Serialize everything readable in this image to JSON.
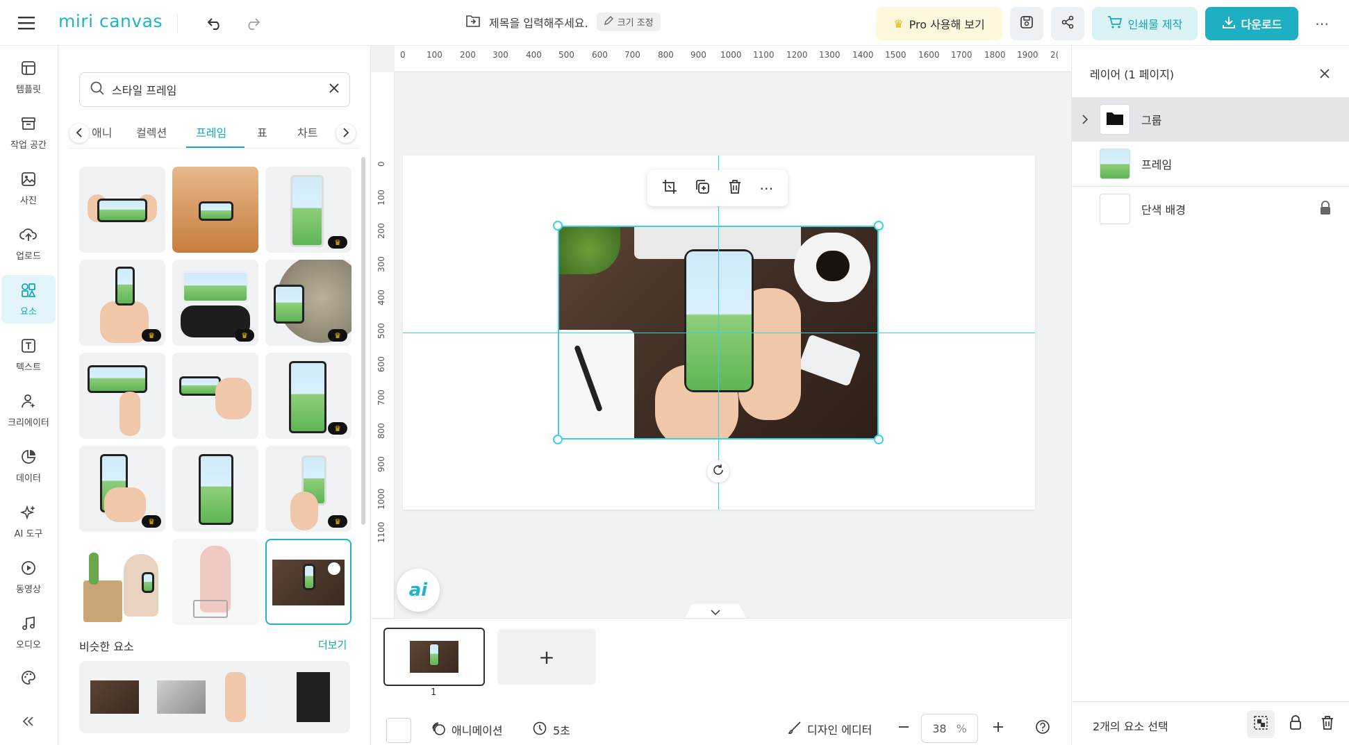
{
  "header": {
    "logo": "miri canvas",
    "title_placeholder": "제목을 입력해주세요.",
    "resize_label": "크기 조정",
    "pro_label": "Pro 사용해 보기",
    "print_label": "인쇄물 제작",
    "download_label": "다운로드"
  },
  "rail": {
    "items": [
      {
        "label": "템플릿",
        "icon": "template-icon"
      },
      {
        "label": "작업 공간",
        "icon": "workspace-icon"
      },
      {
        "label": "사진",
        "icon": "photo-icon"
      },
      {
        "label": "업로드",
        "icon": "upload-icon"
      },
      {
        "label": "요소",
        "icon": "elements-icon"
      },
      {
        "label": "텍스트",
        "icon": "text-icon"
      },
      {
        "label": "크리에이터",
        "icon": "creator-icon"
      },
      {
        "label": "데이터",
        "icon": "data-icon"
      },
      {
        "label": "AI 도구",
        "icon": "ai-tools-icon"
      },
      {
        "label": "동영상",
        "icon": "video-icon"
      },
      {
        "label": "오디오",
        "icon": "audio-icon"
      }
    ],
    "active": "요소"
  },
  "panel": {
    "search_value": "스타일 프레임",
    "tabs": [
      "애니",
      "컬렉션",
      "프레임",
      "표",
      "차트"
    ],
    "active_tab": "프레임",
    "similar_title": "비슷한 요소",
    "more_label": "더보기"
  },
  "canvas": {
    "ruler_h": [
      "0",
      "100",
      "200",
      "300",
      "400",
      "500",
      "600",
      "700",
      "800",
      "900",
      "1000",
      "1100",
      "1200",
      "1300",
      "1400",
      "1500",
      "1600",
      "1700",
      "1800",
      "1900",
      "2("
    ],
    "ruler_v": [
      "0",
      "100",
      "200",
      "300",
      "400",
      "500",
      "600",
      "700",
      "800",
      "900",
      "1000",
      "1100"
    ],
    "ai_label": "ai"
  },
  "pages": {
    "page_number": "1",
    "add_symbol": "+"
  },
  "bottom_bar": {
    "animation_label": "애니메이션",
    "duration_label": "5초",
    "design_editor_label": "디자인 에디터",
    "zoom_value": "38",
    "zoom_unit": "%"
  },
  "layers": {
    "title": "레이어 (1 페이지)",
    "items": [
      {
        "name": "그룹",
        "selected": true
      },
      {
        "name": "프레임",
        "selected": false
      },
      {
        "name": "단색 배경",
        "selected": false,
        "locked": true
      }
    ],
    "footer_label": "2개의 요소 선택"
  },
  "colors": {
    "accent": "#1eafc2",
    "guide": "#38d3e3",
    "pro_bg": "#fdf7dc"
  }
}
